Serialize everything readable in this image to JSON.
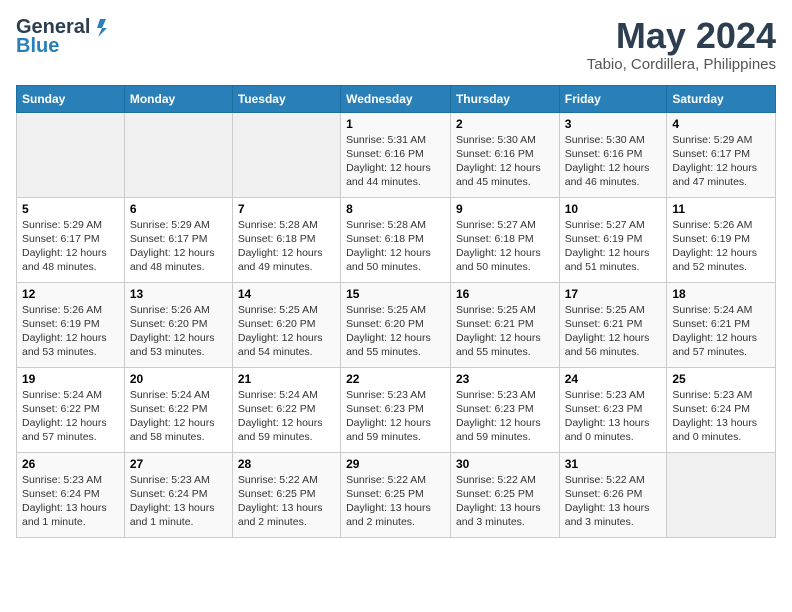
{
  "logo": {
    "line1": "General",
    "line2": "Blue"
  },
  "title": "May 2024",
  "location": "Tabio, Cordillera, Philippines",
  "days_header": [
    "Sunday",
    "Monday",
    "Tuesday",
    "Wednesday",
    "Thursday",
    "Friday",
    "Saturday"
  ],
  "weeks": [
    [
      {
        "day": "",
        "info": ""
      },
      {
        "day": "",
        "info": ""
      },
      {
        "day": "",
        "info": ""
      },
      {
        "day": "1",
        "info": "Sunrise: 5:31 AM\nSunset: 6:16 PM\nDaylight: 12 hours\nand 44 minutes."
      },
      {
        "day": "2",
        "info": "Sunrise: 5:30 AM\nSunset: 6:16 PM\nDaylight: 12 hours\nand 45 minutes."
      },
      {
        "day": "3",
        "info": "Sunrise: 5:30 AM\nSunset: 6:16 PM\nDaylight: 12 hours\nand 46 minutes."
      },
      {
        "day": "4",
        "info": "Sunrise: 5:29 AM\nSunset: 6:17 PM\nDaylight: 12 hours\nand 47 minutes."
      }
    ],
    [
      {
        "day": "5",
        "info": "Sunrise: 5:29 AM\nSunset: 6:17 PM\nDaylight: 12 hours\nand 48 minutes."
      },
      {
        "day": "6",
        "info": "Sunrise: 5:29 AM\nSunset: 6:17 PM\nDaylight: 12 hours\nand 48 minutes."
      },
      {
        "day": "7",
        "info": "Sunrise: 5:28 AM\nSunset: 6:18 PM\nDaylight: 12 hours\nand 49 minutes."
      },
      {
        "day": "8",
        "info": "Sunrise: 5:28 AM\nSunset: 6:18 PM\nDaylight: 12 hours\nand 50 minutes."
      },
      {
        "day": "9",
        "info": "Sunrise: 5:27 AM\nSunset: 6:18 PM\nDaylight: 12 hours\nand 50 minutes."
      },
      {
        "day": "10",
        "info": "Sunrise: 5:27 AM\nSunset: 6:19 PM\nDaylight: 12 hours\nand 51 minutes."
      },
      {
        "day": "11",
        "info": "Sunrise: 5:26 AM\nSunset: 6:19 PM\nDaylight: 12 hours\nand 52 minutes."
      }
    ],
    [
      {
        "day": "12",
        "info": "Sunrise: 5:26 AM\nSunset: 6:19 PM\nDaylight: 12 hours\nand 53 minutes."
      },
      {
        "day": "13",
        "info": "Sunrise: 5:26 AM\nSunset: 6:20 PM\nDaylight: 12 hours\nand 53 minutes."
      },
      {
        "day": "14",
        "info": "Sunrise: 5:25 AM\nSunset: 6:20 PM\nDaylight: 12 hours\nand 54 minutes."
      },
      {
        "day": "15",
        "info": "Sunrise: 5:25 AM\nSunset: 6:20 PM\nDaylight: 12 hours\nand 55 minutes."
      },
      {
        "day": "16",
        "info": "Sunrise: 5:25 AM\nSunset: 6:21 PM\nDaylight: 12 hours\nand 55 minutes."
      },
      {
        "day": "17",
        "info": "Sunrise: 5:25 AM\nSunset: 6:21 PM\nDaylight: 12 hours\nand 56 minutes."
      },
      {
        "day": "18",
        "info": "Sunrise: 5:24 AM\nSunset: 6:21 PM\nDaylight: 12 hours\nand 57 minutes."
      }
    ],
    [
      {
        "day": "19",
        "info": "Sunrise: 5:24 AM\nSunset: 6:22 PM\nDaylight: 12 hours\nand 57 minutes."
      },
      {
        "day": "20",
        "info": "Sunrise: 5:24 AM\nSunset: 6:22 PM\nDaylight: 12 hours\nand 58 minutes."
      },
      {
        "day": "21",
        "info": "Sunrise: 5:24 AM\nSunset: 6:22 PM\nDaylight: 12 hours\nand 59 minutes."
      },
      {
        "day": "22",
        "info": "Sunrise: 5:23 AM\nSunset: 6:23 PM\nDaylight: 12 hours\nand 59 minutes."
      },
      {
        "day": "23",
        "info": "Sunrise: 5:23 AM\nSunset: 6:23 PM\nDaylight: 12 hours\nand 59 minutes."
      },
      {
        "day": "24",
        "info": "Sunrise: 5:23 AM\nSunset: 6:23 PM\nDaylight: 13 hours\nand 0 minutes."
      },
      {
        "day": "25",
        "info": "Sunrise: 5:23 AM\nSunset: 6:24 PM\nDaylight: 13 hours\nand 0 minutes."
      }
    ],
    [
      {
        "day": "26",
        "info": "Sunrise: 5:23 AM\nSunset: 6:24 PM\nDaylight: 13 hours\nand 1 minute."
      },
      {
        "day": "27",
        "info": "Sunrise: 5:23 AM\nSunset: 6:24 PM\nDaylight: 13 hours\nand 1 minute."
      },
      {
        "day": "28",
        "info": "Sunrise: 5:22 AM\nSunset: 6:25 PM\nDaylight: 13 hours\nand 2 minutes."
      },
      {
        "day": "29",
        "info": "Sunrise: 5:22 AM\nSunset: 6:25 PM\nDaylight: 13 hours\nand 2 minutes."
      },
      {
        "day": "30",
        "info": "Sunrise: 5:22 AM\nSunset: 6:25 PM\nDaylight: 13 hours\nand 3 minutes."
      },
      {
        "day": "31",
        "info": "Sunrise: 5:22 AM\nSunset: 6:26 PM\nDaylight: 13 hours\nand 3 minutes."
      },
      {
        "day": "",
        "info": ""
      }
    ]
  ]
}
